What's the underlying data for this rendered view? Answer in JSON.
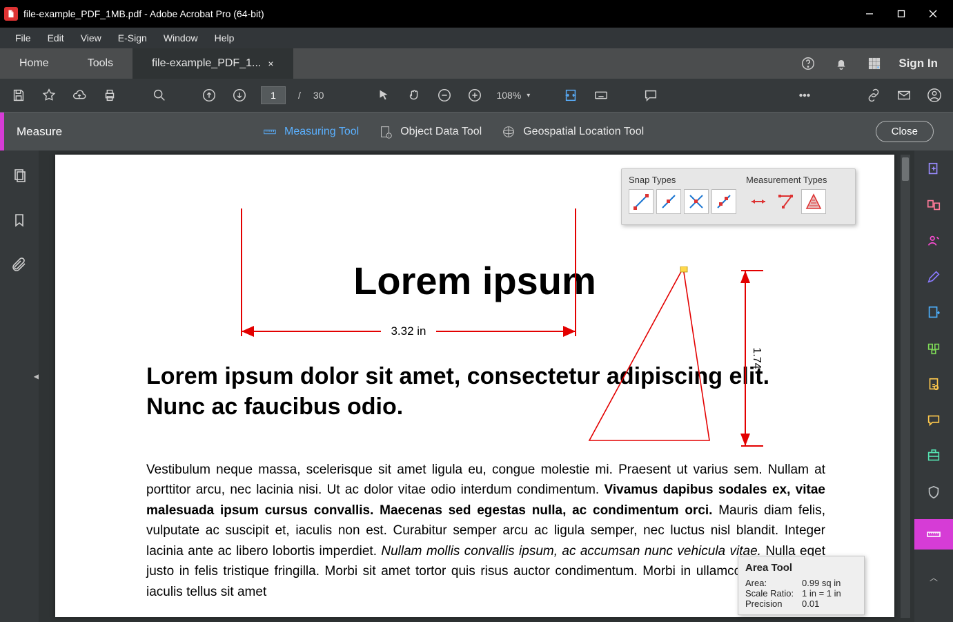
{
  "window": {
    "title": "file-example_PDF_1MB.pdf - Adobe Acrobat Pro (64-bit)"
  },
  "menu": {
    "items": [
      "File",
      "Edit",
      "View",
      "E-Sign",
      "Window",
      "Help"
    ]
  },
  "apptabs": {
    "home": "Home",
    "tools": "Tools",
    "doc": "file-example_PDF_1...",
    "signin": "Sign In"
  },
  "toolbar": {
    "page_current": "1",
    "page_sep": "/",
    "page_total": "30",
    "zoom": "108%"
  },
  "subtoolbar": {
    "title": "Measure",
    "measuring": "Measuring Tool",
    "objectdata": "Object Data Tool",
    "geo": "Geospatial Location Tool",
    "close": "Close"
  },
  "snap_panel": {
    "snap_title": "Snap Types",
    "meas_title": "Measurement Types"
  },
  "document": {
    "h1": "Lorem ipsum",
    "h2": "Lorem ipsum dolor sit amet, consectetur adipiscing elit. Nunc ac faucibus odio.",
    "body_plain_1": "Vestibulum neque massa, scelerisque sit amet ligula eu, congue molestie mi. Praesent ut varius sem. Nullam at porttitor arcu, nec lacinia nisi. Ut ac dolor vitae odio interdum condimentum. ",
    "body_bold": "Vivamus dapibus sodales ex, vitae malesuada ipsum cursus convallis. Maecenas sed egestas nulla, ac condimentum orci.",
    "body_plain_2": " Mauris diam felis, vulputate ac suscipit et, iaculis non est. Curabitur semper arcu ac ligula semper, nec luctus nisl blandit. Integer lacinia ante ac libero lobortis imperdiet. ",
    "body_italic": "Nullam mollis convallis ipsum, ac accumsan nunc vehicula vitae.",
    "body_plain_3": " Nulla eget justo in felis tristique fringilla. Morbi sit amet tortor quis risus auctor condimentum. Morbi in ullamcorper elit. Nulla iaculis tellus sit amet"
  },
  "measurements": {
    "horizontal": "3.32 in",
    "vertical": "1.74"
  },
  "area_tool": {
    "title": "Area Tool",
    "area_k": "Area:",
    "area_v": "0.99 sq in",
    "scale_k": "Scale Ratio:",
    "scale_v": "1 in = 1 in",
    "prec_k": "Precision",
    "prec_v": "0.01"
  }
}
